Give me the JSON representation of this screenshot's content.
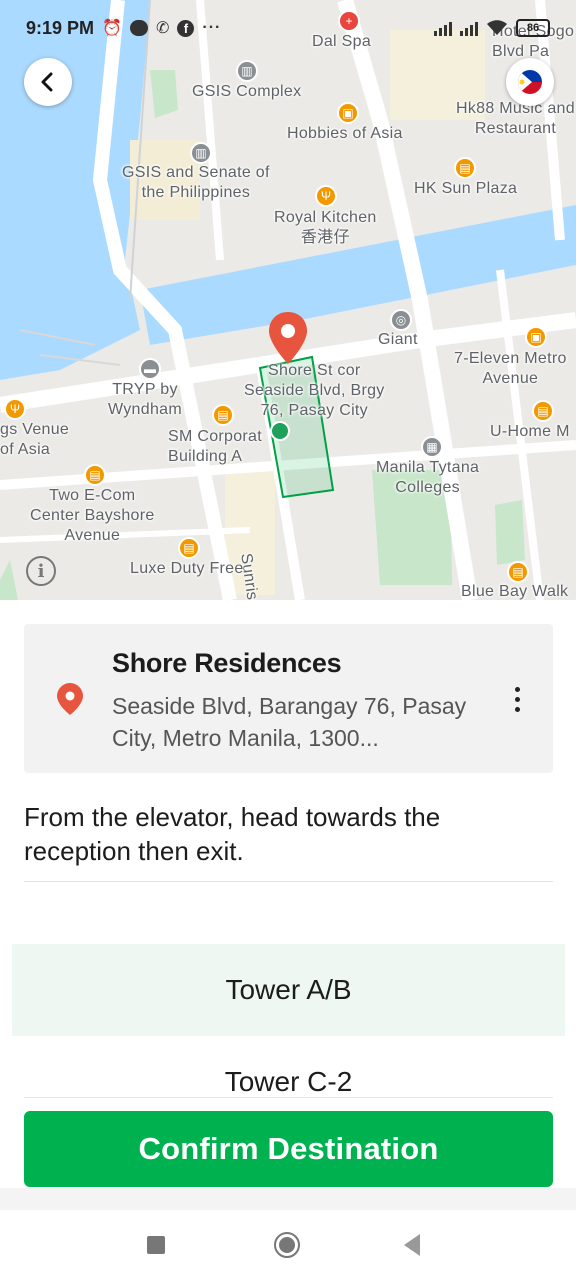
{
  "status_bar": {
    "time": "9:19 PM",
    "battery": "86",
    "notification_icons": [
      "alarm-icon",
      "talk-icon",
      "viber-icon",
      "facebook-icon",
      "more-dots-icon"
    ]
  },
  "map": {
    "labels": {
      "dal_spa": "Dal Spa",
      "hotel_sogo": "Hotel Sogo\nBlvd Pa",
      "gsis_complex": "GSIS Complex",
      "hobbies_of_asia": "Hobbies of Asia",
      "hk88": "Hk88 Music and\nRestaurant",
      "gsis_senate": "GSIS and Senate of\nthe Philippines",
      "hk_sun_plaza": "HK Sun Plaza",
      "royal_kitchen": "Royal Kitchen\n香港仔",
      "giant": "Giant",
      "seven_eleven": "7-Eleven Metro\nAvenue",
      "tryp": "TRYP by\nWyndham",
      "pin_address": "Shore St cor\nSeaside Blvd, Brgy\n76, Pasay City",
      "u_home": "U-Home M",
      "venue_asia": "gs Venue\nof Asia",
      "sm_corporate": "SM Corporat\nBuilding A",
      "manila_tytana": "Manila Tytana\nColleges",
      "two_ecom": "Two E-Com\nCenter Bayshore\nAvenue",
      "sunrise_dr": "Sunrise Dr",
      "luxe_duty_free": "Luxe Duty Free",
      "blue_bay_walk": "Blue Bay Walk"
    },
    "colors": {
      "land": "#eceae6",
      "water": "#aadaff",
      "park": "#c8e6c9",
      "road": "#ffffff",
      "pin": "#e8553f",
      "accent": "#00b14f"
    }
  },
  "place": {
    "name": "Shore Residences",
    "address": "Seaside Blvd, Barangay 76, Pasay City, Metro Manila, 1300..."
  },
  "instructions": "From the elevator, head towards the reception then exit.",
  "options": [
    "Tower A/B",
    "Tower C-2"
  ],
  "selected_option": "Tower A/B",
  "confirm_label": "Confirm Destination"
}
